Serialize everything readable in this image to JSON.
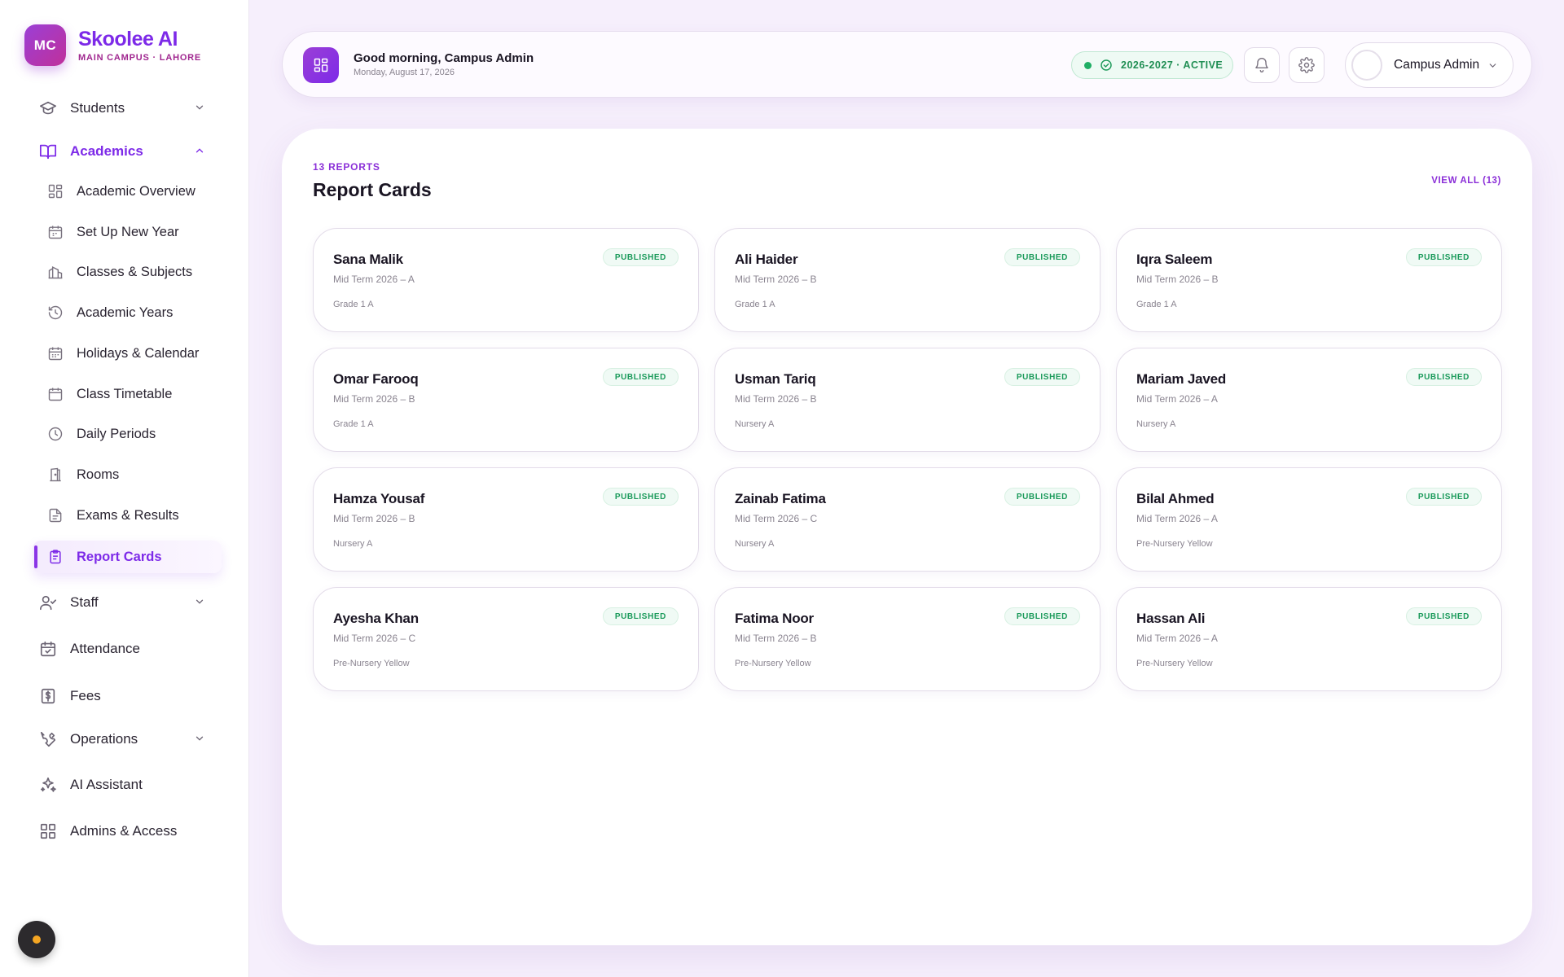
{
  "brand": {
    "initials": "MC",
    "name": "Skoolee AI",
    "subtitle": "MAIN CAMPUS · LAHORE"
  },
  "sidebar": {
    "items": [
      {
        "label": "Students",
        "icon": "graduation-cap-icon",
        "expandable": true,
        "open": false
      },
      {
        "label": "Academics",
        "icon": "book-open-icon",
        "expandable": true,
        "open": true
      },
      {
        "label": "Staff",
        "icon": "users-icon",
        "expandable": true,
        "open": false
      },
      {
        "label": "Attendance",
        "icon": "calendar-check-icon",
        "expandable": false
      },
      {
        "label": "Fees",
        "icon": "dollar-receipt-icon",
        "expandable": false
      },
      {
        "label": "Operations",
        "icon": "wrench-icon",
        "expandable": true,
        "open": false
      },
      {
        "label": "AI Assistant",
        "icon": "sparkles-icon",
        "expandable": false
      },
      {
        "label": "Admins & Access",
        "icon": "grid-icon",
        "expandable": false
      }
    ],
    "academics_subitems": [
      {
        "label": "Academic Overview",
        "icon": "dashboard-icon"
      },
      {
        "label": "Set Up New Year",
        "icon": "calendar-icon"
      },
      {
        "label": "Classes & Subjects",
        "icon": "school-icon"
      },
      {
        "label": "Academic Years",
        "icon": "history-icon"
      },
      {
        "label": "Holidays & Calendar",
        "icon": "calendar-days-icon"
      },
      {
        "label": "Class Timetable",
        "icon": "calendar-icon"
      },
      {
        "label": "Daily Periods",
        "icon": "clock-icon"
      },
      {
        "label": "Rooms",
        "icon": "door-icon"
      },
      {
        "label": "Exams & Results",
        "icon": "file-text-icon"
      },
      {
        "label": "Report Cards",
        "icon": "clipboard-icon",
        "active": true
      }
    ]
  },
  "header": {
    "greeting": "Good morning, Campus Admin",
    "date": "Monday, August 17, 2026",
    "year_status": "2026-2027 · ACTIVE",
    "user_name": "Campus Admin"
  },
  "main": {
    "count_label": "13 REPORTS",
    "title": "Report Cards",
    "view_all": "VIEW ALL (13)",
    "cards": [
      {
        "name": "Sana Malik",
        "term": "Mid Term 2026 – A",
        "class": "Grade 1 A",
        "status": "PUBLISHED"
      },
      {
        "name": "Ali Haider",
        "term": "Mid Term 2026 – B",
        "class": "Grade 1 A",
        "status": "PUBLISHED"
      },
      {
        "name": "Iqra Saleem",
        "term": "Mid Term 2026 – B",
        "class": "Grade 1 A",
        "status": "PUBLISHED"
      },
      {
        "name": "Omar Farooq",
        "term": "Mid Term 2026 – B",
        "class": "Grade 1 A",
        "status": "PUBLISHED"
      },
      {
        "name": "Usman Tariq",
        "term": "Mid Term 2026 – B",
        "class": "Nursery A",
        "status": "PUBLISHED"
      },
      {
        "name": "Mariam Javed",
        "term": "Mid Term 2026 – A",
        "class": "Nursery A",
        "status": "PUBLISHED"
      },
      {
        "name": "Hamza Yousaf",
        "term": "Mid Term 2026 – B",
        "class": "Nursery A",
        "status": "PUBLISHED"
      },
      {
        "name": "Zainab Fatima",
        "term": "Mid Term 2026 – C",
        "class": "Nursery A",
        "status": "PUBLISHED"
      },
      {
        "name": "Bilal Ahmed",
        "term": "Mid Term 2026 – A",
        "class": "Pre-Nursery Yellow",
        "status": "PUBLISHED"
      },
      {
        "name": "Ayesha Khan",
        "term": "Mid Term 2026 – C",
        "class": "Pre-Nursery Yellow",
        "status": "PUBLISHED"
      },
      {
        "name": "Fatima Noor",
        "term": "Mid Term 2026 – B",
        "class": "Pre-Nursery Yellow",
        "status": "PUBLISHED"
      },
      {
        "name": "Hassan Ali",
        "term": "Mid Term 2026 – A",
        "class": "Pre-Nursery Yellow",
        "status": "PUBLISHED"
      }
    ]
  },
  "colors": {
    "accent": "#7d2ae8",
    "published": "#1a9a5a",
    "active_status": "#1fae64"
  }
}
